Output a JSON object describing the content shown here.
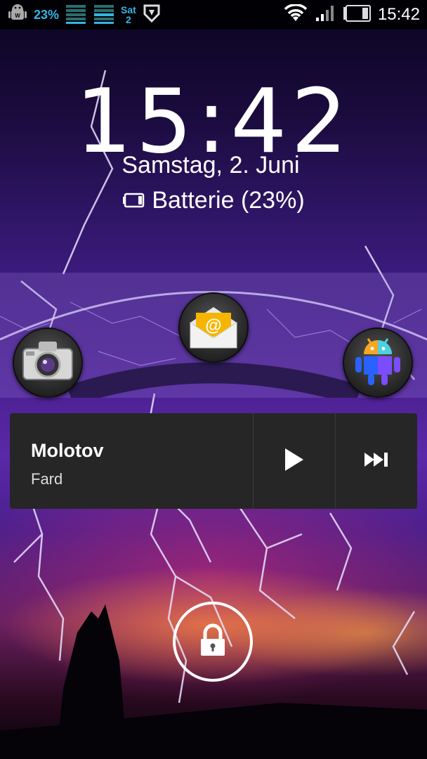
{
  "status_bar": {
    "battery_percent_text": "23%",
    "day_short": "Sat",
    "day_num": "2",
    "time": "15:42",
    "battery_level": 0.23
  },
  "lockscreen": {
    "time": "15:42",
    "date": "Samstag, 2. Juni",
    "battery_text": "Batterie (23%)"
  },
  "shortcuts": [
    {
      "name": "camera-shortcut",
      "icon": "camera-icon"
    },
    {
      "name": "email-shortcut",
      "icon": "email-icon"
    },
    {
      "name": "android-shortcut",
      "icon": "android-icon"
    }
  ],
  "music": {
    "title": "Molotov",
    "artist": "Fard",
    "play_icon": "play-icon",
    "next_icon": "next-track-icon"
  },
  "unlock": {
    "icon": "lock-icon"
  },
  "colors": {
    "accent_blue": "#33b5e5",
    "widget_bg": "#262626",
    "email_yellow": "#f6b500"
  }
}
